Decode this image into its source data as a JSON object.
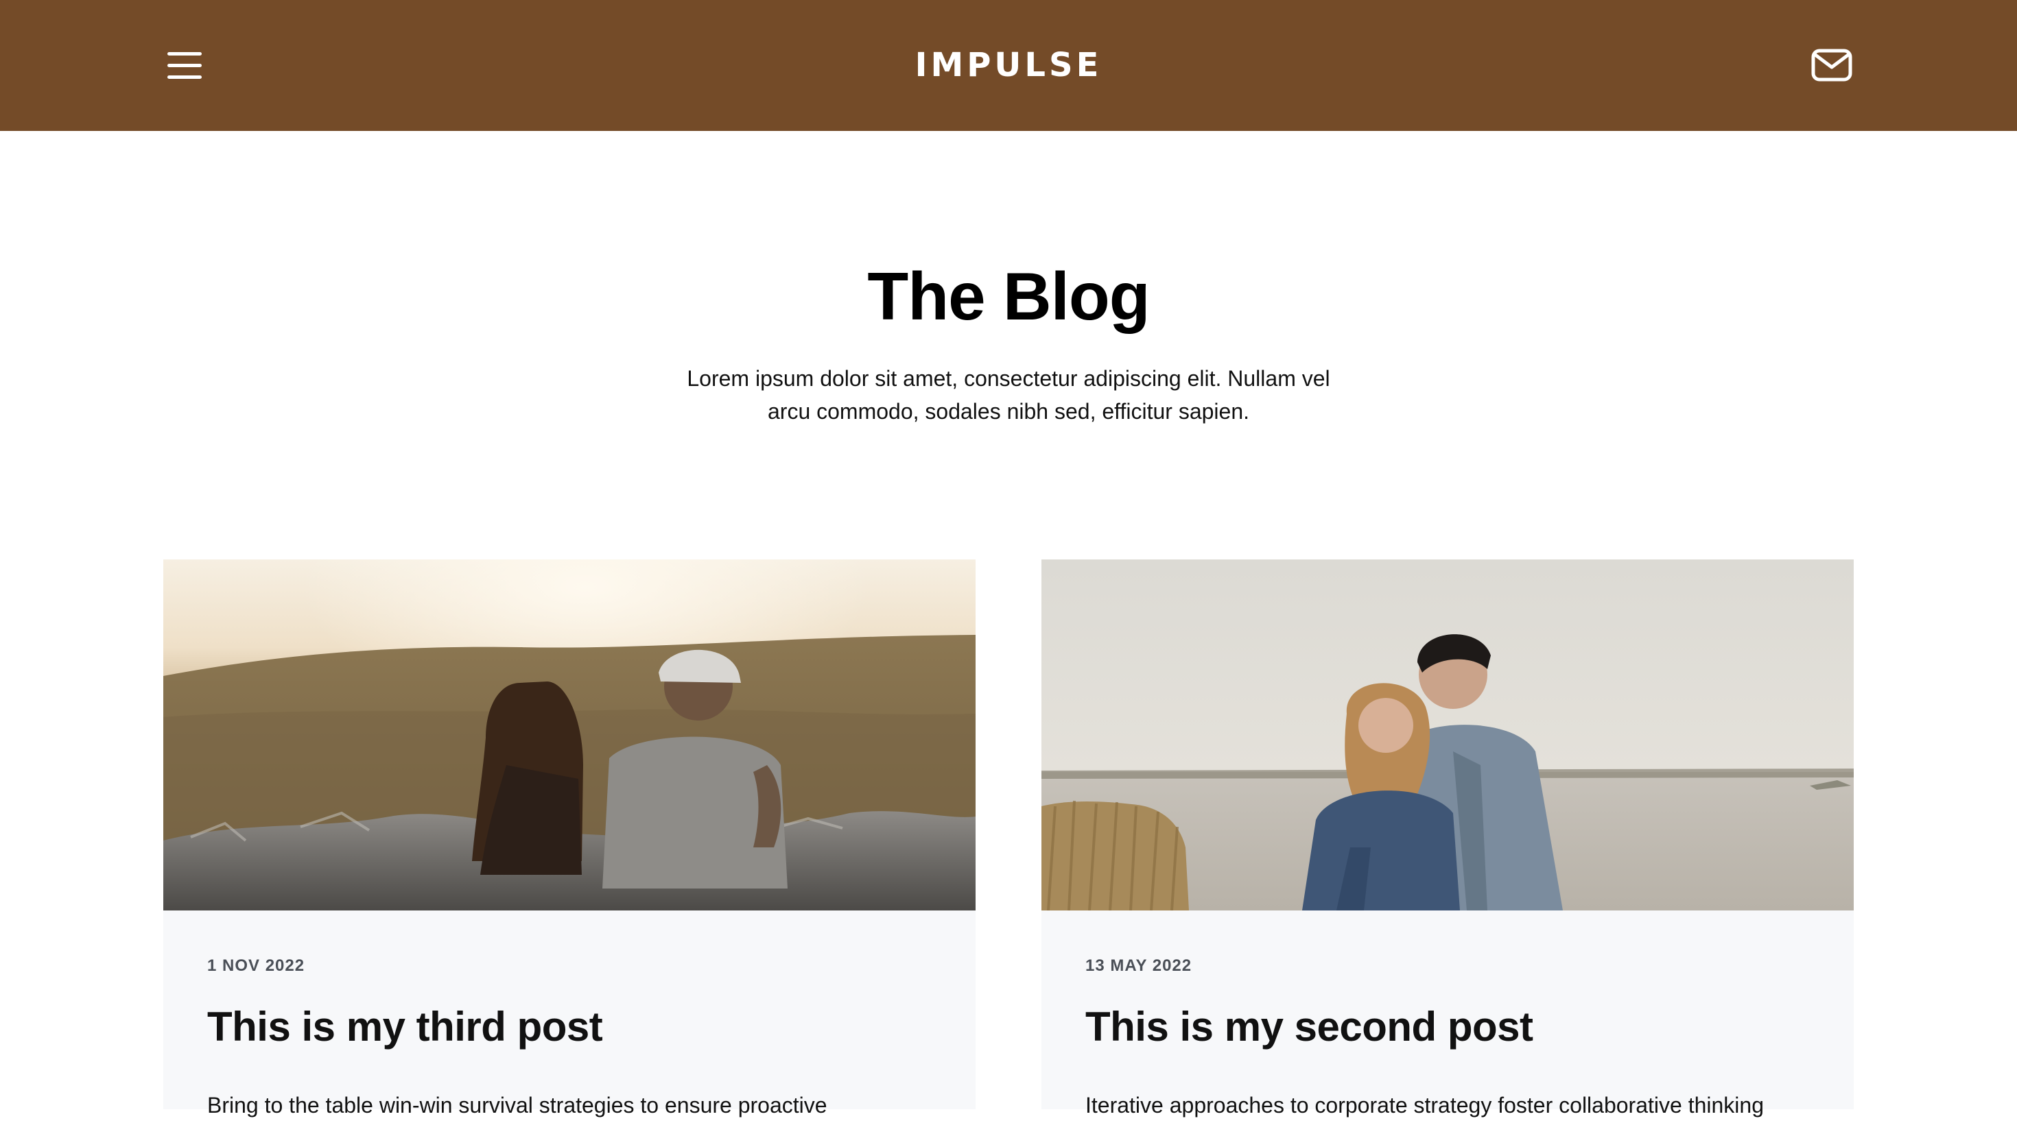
{
  "header": {
    "brand": "IMPULSE",
    "menu_icon": "hamburger-menu-icon",
    "contact_icon": "mail-icon",
    "background_color": "#744b28"
  },
  "hero": {
    "title": "The Blog",
    "subtitle": "Lorem ipsum dolor sit amet, consectetur adipiscing elit. Nullam vel arcu commodo, sodales nibh sed, efficitur sapien."
  },
  "posts": [
    {
      "date": "1 NOV 2022",
      "title": "This is my third post",
      "excerpt": "Bring to the table win-win survival strategies to ensure proactive"
    },
    {
      "date": "13 MAY 2022",
      "title": "This is my second post",
      "excerpt": "Iterative approaches to corporate strategy foster collaborative thinking"
    }
  ]
}
